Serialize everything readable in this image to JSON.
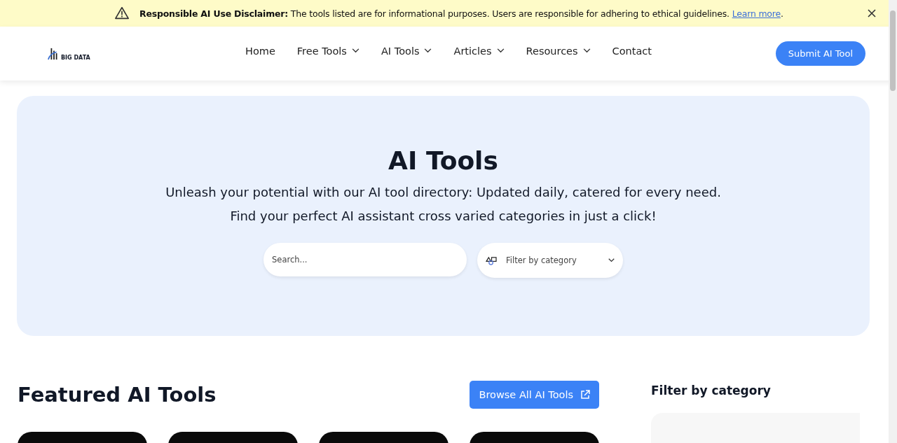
{
  "disclaimer": {
    "title": "Responsible AI Use Disclaimer:",
    "text": "The tools listed are for informational purposes. Users are responsible for adhering to ethical guidelines.",
    "link": "Learn more",
    "end": "."
  },
  "header": {
    "logo_text": "BIG DATA",
    "nav": [
      {
        "label": "Home",
        "dropdown": false
      },
      {
        "label": "Free Tools",
        "dropdown": true
      },
      {
        "label": "AI Tools",
        "dropdown": true
      },
      {
        "label": "Articles",
        "dropdown": true
      },
      {
        "label": "Resources",
        "dropdown": true
      },
      {
        "label": "Contact",
        "dropdown": false
      }
    ],
    "cta": "Submit AI Tool"
  },
  "hero": {
    "title": "AI Tools",
    "lines": [
      "Unleash your potential with our AI tool directory: Updated daily, catered for every need.",
      "Find your perfect AI assistant cross varied categories in just a click!"
    ],
    "search": {
      "placeholder": "Search..."
    },
    "filter": {
      "label": "Filter by category"
    }
  },
  "featured": {
    "title": "Featured AI Tools",
    "button": "Browse All AI Tools",
    "cards": [
      {
        "kind": "tool"
      },
      {
        "kind": "tool"
      },
      {
        "kind": "tool"
      },
      {
        "kind": "tool"
      }
    ]
  },
  "sidebar": {
    "title": "Filter by category"
  }
}
